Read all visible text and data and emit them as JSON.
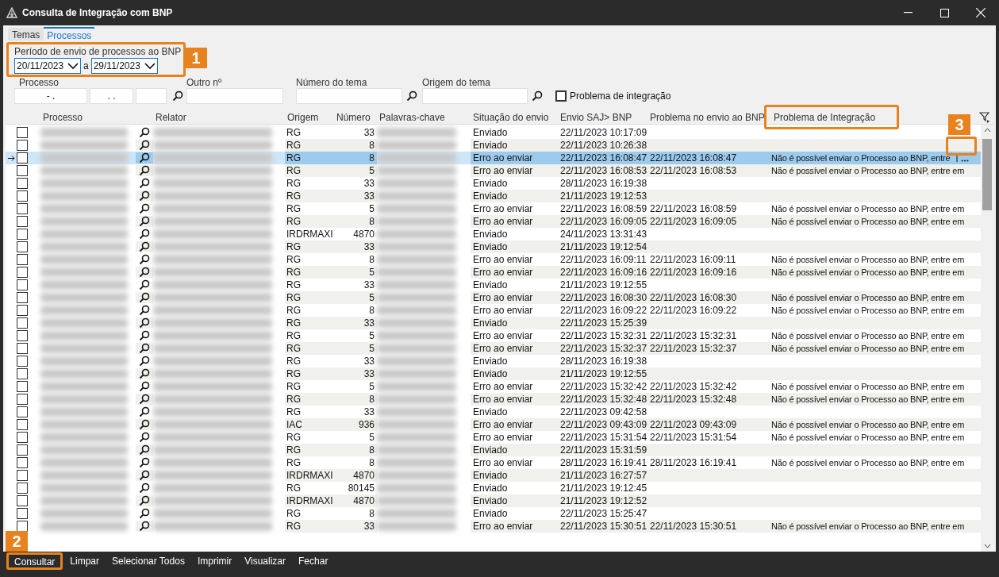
{
  "window": {
    "title": "Consulta de Integração com BNP"
  },
  "tabs": [
    {
      "label": "Temas",
      "selected": false
    },
    {
      "label": "Processos",
      "selected": true
    }
  ],
  "period": {
    "label": "Período de envio de processos ao BNP",
    "from": "20/11/2023",
    "separator": "a",
    "to": "29/11/2023"
  },
  "filters": {
    "processo_label": "Processo",
    "processo_parts": [
      "- .",
      ". ."
    ],
    "outro_label": "Outro nº",
    "numero_tema_label": "Número do tema",
    "origem_tema_label": "Origem do tema",
    "problema_checkbox": {
      "label": "Problema de integração",
      "checked": false
    }
  },
  "table": {
    "columns": [
      "Processo",
      "Relator",
      "Origem",
      "Número",
      "Palavras-chave",
      "Situação do envio",
      "Envio SAJ> BNP",
      "Problema no envio ao BNP",
      "Problema de Integração"
    ],
    "rows": [
      {
        "origem": "RG",
        "numero": "33",
        "situacao": "Enviado",
        "envio": "22/11/2023 10:17:09",
        "selected": false,
        "checked": false
      },
      {
        "origem": "RG",
        "numero": "8",
        "situacao": "Enviado",
        "envio": "22/11/2023 10:26:38",
        "selected": false,
        "checked": false
      },
      {
        "origem": "RG",
        "numero": "8",
        "situacao": "Erro ao enviar",
        "envio": "22/11/2023 16:08:47",
        "problema_envio": "22/11/2023 16:08:47",
        "problema_integracao": "Não é possível enviar o Processo ao BNP, entre",
        "truncated": true,
        "selected": true,
        "checked": false
      },
      {
        "origem": "RG",
        "numero": "5",
        "situacao": "Erro ao enviar",
        "envio": "22/11/2023 16:08:53",
        "problema_envio": "22/11/2023 16:08:53",
        "problema_integracao": "Não é possível enviar o Processo ao BNP, entre em",
        "selected": false,
        "checked": false
      },
      {
        "origem": "RG",
        "numero": "33",
        "situacao": "Enviado",
        "envio": "28/11/2023 16:19:38",
        "selected": false,
        "checked": false
      },
      {
        "origem": "RG",
        "numero": "33",
        "situacao": "Enviado",
        "envio": "21/11/2023 19:12:53",
        "selected": false,
        "checked": false
      },
      {
        "origem": "RG",
        "numero": "5",
        "situacao": "Erro ao enviar",
        "envio": "22/11/2023 16:08:59",
        "problema_envio": "22/11/2023 16:08:59",
        "problema_integracao": "Não é possível enviar o Processo ao BNP, entre em",
        "selected": false,
        "checked": false
      },
      {
        "origem": "RG",
        "numero": "8",
        "situacao": "Erro ao enviar",
        "envio": "22/11/2023 16:09:05",
        "problema_envio": "22/11/2023 16:09:05",
        "problema_integracao": "Não é possível enviar o Processo ao BNP, entre em",
        "selected": false,
        "checked": false
      },
      {
        "origem": "IRDRMAXI",
        "numero": "4870",
        "situacao": "Enviado",
        "envio": "24/11/2023 13:31:43",
        "selected": false,
        "checked": false
      },
      {
        "origem": "RG",
        "numero": "33",
        "situacao": "Enviado",
        "envio": "21/11/2023 19:12:54",
        "selected": false,
        "checked": false
      },
      {
        "origem": "RG",
        "numero": "8",
        "situacao": "Erro ao enviar",
        "envio": "22/11/2023 16:09:11",
        "problema_envio": "22/11/2023 16:09:11",
        "problema_integracao": "Não é possível enviar o Processo ao BNP, entre em",
        "selected": false,
        "checked": false
      },
      {
        "origem": "RG",
        "numero": "5",
        "situacao": "Erro ao enviar",
        "envio": "22/11/2023 16:09:16",
        "problema_envio": "22/11/2023 16:09:16",
        "problema_integracao": "Não é possível enviar o Processo ao BNP, entre em",
        "selected": false,
        "checked": false
      },
      {
        "origem": "RG",
        "numero": "33",
        "situacao": "Enviado",
        "envio": "21/11/2023 19:12:55",
        "selected": false,
        "checked": false
      },
      {
        "origem": "RG",
        "numero": "5",
        "situacao": "Erro ao enviar",
        "envio": "22/11/2023 16:08:30",
        "problema_envio": "22/11/2023 16:08:30",
        "problema_integracao": "Não é possível enviar o Processo ao BNP, entre em",
        "selected": false,
        "checked": false
      },
      {
        "origem": "RG",
        "numero": "8",
        "situacao": "Erro ao enviar",
        "envio": "22/11/2023 16:09:22",
        "problema_envio": "22/11/2023 16:09:22",
        "problema_integracao": "Não é possível enviar o Processo ao BNP, entre em",
        "selected": false,
        "checked": false
      },
      {
        "origem": "RG",
        "numero": "33",
        "situacao": "Enviado",
        "envio": "22/11/2023 15:25:39",
        "selected": false,
        "checked": false
      },
      {
        "origem": "RG",
        "numero": "5",
        "situacao": "Erro ao enviar",
        "envio": "22/11/2023 15:32:31",
        "problema_envio": "22/11/2023 15:32:31",
        "problema_integracao": "Não é possível enviar o Processo ao BNP, entre em",
        "selected": false,
        "checked": false
      },
      {
        "origem": "RG",
        "numero": "5",
        "situacao": "Erro ao enviar",
        "envio": "22/11/2023 15:32:37",
        "problema_envio": "22/11/2023 15:32:37",
        "problema_integracao": "Não é possível enviar o Processo ao BNP, entre em",
        "selected": false,
        "checked": false
      },
      {
        "origem": "RG",
        "numero": "33",
        "situacao": "Enviado",
        "envio": "28/11/2023 16:19:38",
        "selected": false,
        "checked": false
      },
      {
        "origem": "RG",
        "numero": "33",
        "situacao": "Enviado",
        "envio": "21/11/2023 19:12:55",
        "selected": false,
        "checked": false
      },
      {
        "origem": "RG",
        "numero": "5",
        "situacao": "Erro ao enviar",
        "envio": "22/11/2023 15:32:42",
        "problema_envio": "22/11/2023 15:32:42",
        "problema_integracao": "Não é possível enviar o Processo ao BNP, entre em",
        "selected": false,
        "checked": false
      },
      {
        "origem": "RG",
        "numero": "8",
        "situacao": "Erro ao enviar",
        "envio": "22/11/2023 15:32:48",
        "problema_envio": "22/11/2023 15:32:48",
        "problema_integracao": "Não é possível enviar o Processo ao BNP, entre em",
        "selected": false,
        "checked": false
      },
      {
        "origem": "RG",
        "numero": "33",
        "situacao": "Enviado",
        "envio": "22/11/2023 09:42:58",
        "selected": false,
        "checked": false
      },
      {
        "origem": "IAC",
        "numero": "936",
        "situacao": "Erro ao enviar",
        "envio": "22/11/2023 09:43:09",
        "problema_envio": "22/11/2023 09:43:09",
        "problema_integracao": "Não é possível enviar o Processo ao BNP, entre em",
        "selected": false,
        "checked": false
      },
      {
        "origem": "RG",
        "numero": "5",
        "situacao": "Erro ao enviar",
        "envio": "22/11/2023 15:31:54",
        "problema_envio": "22/11/2023 15:31:54",
        "problema_integracao": "Não é possível enviar o Processo ao BNP, entre em",
        "selected": false,
        "checked": false
      },
      {
        "origem": "RG",
        "numero": "8",
        "situacao": "Enviado",
        "envio": "22/11/2023 15:31:59",
        "selected": false,
        "checked": false
      },
      {
        "origem": "RG",
        "numero": "8",
        "situacao": "Erro ao enviar",
        "envio": "28/11/2023 16:19:41",
        "problema_envio": "28/11/2023 16:19:41",
        "problema_integracao": "Não é possível enviar o Processo ao BNP, entre em",
        "selected": false,
        "checked": false
      },
      {
        "origem": "IRDRMAXI",
        "numero": "4870",
        "situacao": "Enviado",
        "envio": "21/11/2023 16:27:57",
        "selected": false,
        "checked": false
      },
      {
        "origem": "RG",
        "numero": "80145",
        "situacao": "Enviado",
        "envio": "21/11/2023 19:12:45",
        "selected": false,
        "checked": false
      },
      {
        "origem": "IRDRMAXI",
        "numero": "4870",
        "situacao": "Enviado",
        "envio": "21/11/2023 19:12:52",
        "selected": false,
        "checked": false
      },
      {
        "origem": "RG",
        "numero": "8",
        "situacao": "Enviado",
        "envio": "22/11/2023 15:25:47",
        "selected": false,
        "checked": false
      },
      {
        "origem": "RG",
        "numero": "33",
        "situacao": "Erro ao enviar",
        "envio": "22/11/2023 15:30:51",
        "problema_envio": "22/11/2023 15:30:51",
        "problema_integracao": "Não é possível enviar o Processo ao BNP, entre em",
        "selected": false,
        "checked": false
      }
    ]
  },
  "buttons": [
    "Consultar",
    "Limpar",
    "Selecionar Todos",
    "Imprimir",
    "Visualizar",
    "Fechar"
  ],
  "annotations": [
    "1",
    "2",
    "3"
  ]
}
